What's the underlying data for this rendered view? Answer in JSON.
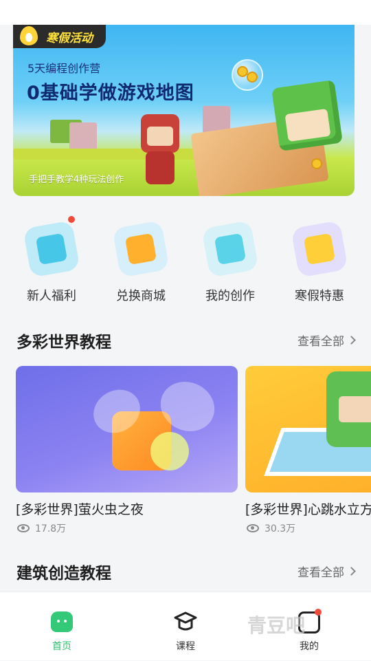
{
  "banner": {
    "tag": "寒假活动",
    "subtitle": "5天编程创作营",
    "title": "0基础学做游戏地图",
    "caption": "手把手教学4种玩法创作"
  },
  "quick_menu": [
    {
      "label": "新人福利",
      "badge": true,
      "color": "#46c7e8",
      "accent": "#ef4f4a"
    },
    {
      "label": "兑换商城",
      "badge": false,
      "color": "#ffb12e",
      "accent": "#e5443a"
    },
    {
      "label": "我的创作",
      "badge": false,
      "color": "#5ad3e8",
      "accent": "#f26a8a"
    },
    {
      "label": "寒假特惠",
      "badge": false,
      "color": "#ffcf3a",
      "accent": "#7d6cf0"
    }
  ],
  "section_colorful": {
    "title": "多彩世界教程",
    "see_all": "查看全部"
  },
  "cards": [
    {
      "title": "[多彩世界]萤火虫之夜",
      "views": "17.8万"
    },
    {
      "title": "[多彩世界]心跳水立方",
      "views": "30.3万"
    }
  ],
  "section_building": {
    "title": "建筑创造教程",
    "see_all": "查看全部"
  },
  "bottom_nav": [
    {
      "label": "首页",
      "icon": "home-icon",
      "active": true
    },
    {
      "label": "课程",
      "icon": "graduation-cap-icon",
      "active": false
    },
    {
      "label": "我的",
      "icon": "profile-icon",
      "active": false,
      "badge": true
    }
  ],
  "watermark": "青豆吧",
  "colors": {
    "accent_green": "#2dbf6c",
    "badge_red": "#f04a3a"
  }
}
